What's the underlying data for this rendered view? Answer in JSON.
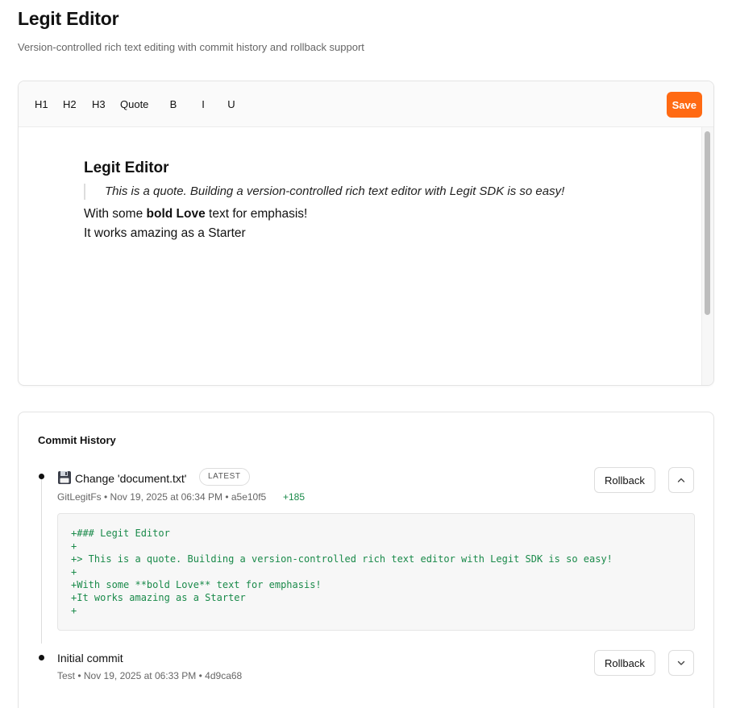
{
  "header": {
    "title": "Legit Editor",
    "subtitle": "Version-controlled rich text editing with commit history and rollback support"
  },
  "toolbar": {
    "h1": "H1",
    "h2": "H2",
    "h3": "H3",
    "quote": "Quote",
    "bold": "B",
    "italic": "I",
    "underline": "U",
    "save": "Save"
  },
  "document": {
    "heading": "Legit Editor",
    "quote": "This is a quote. Building a version-controlled rich text editor with Legit SDK is so easy!",
    "line1_prefix": "With some ",
    "line1_bold": "bold Love",
    "line1_suffix": " text for emphasis!",
    "line2": "It works amazing as a Starter"
  },
  "history": {
    "title": "Commit History",
    "commits": [
      {
        "icon": "floppy-disk-icon",
        "title": "Change 'document.txt'",
        "badge": "LATEST",
        "meta": "GitLegitFs • Nov 19, 2025 at 06:34 PM • a5e10f5",
        "additions": "+185",
        "rollback": "Rollback",
        "expanded": true,
        "diff": [
          "+### Legit Editor",
          "+",
          "+> This is a quote. Building a version-controlled rich text editor with Legit SDK is so easy!",
          "+",
          "+With some **bold Love** text for emphasis!",
          "+It works amazing as a Starter",
          "+"
        ]
      },
      {
        "title": "Initial commit",
        "meta": "Test • Nov 19, 2025 at 06:33 PM • 4d9ca68",
        "rollback": "Rollback",
        "expanded": false
      }
    ]
  },
  "colors": {
    "accent": "#ff6a13",
    "diff_add": "#1a8a4a"
  }
}
